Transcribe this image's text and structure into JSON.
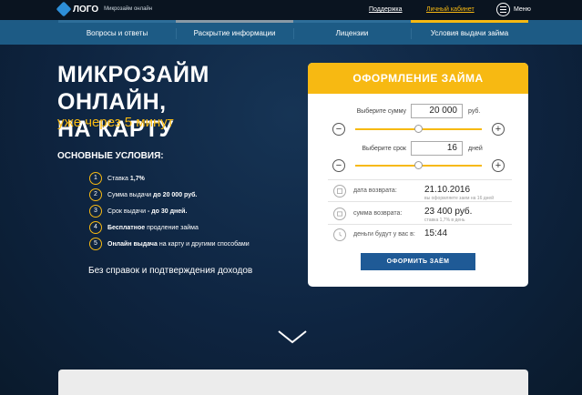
{
  "header": {
    "logo_text": "ЛОГО",
    "logo_sub": "Микрозайм онлайн",
    "support_link": "Поддержка",
    "cabinet_link": "Личный кабинет",
    "menu_label": "Меню"
  },
  "nav": {
    "items": [
      {
        "label": "Вопросы и ответы"
      },
      {
        "label": "Раскрытие информации"
      },
      {
        "label": "Лицензии"
      },
      {
        "label": "Условия выдачи займа"
      }
    ]
  },
  "hero": {
    "title_line1": "МИКРОЗАЙМ ОНЛАЙН,",
    "title_line2": "НА КАРТУ",
    "subtitle": "уже через 5 минут",
    "conditions_title": "ОСНОВНЫЕ УСЛОВИЯ:",
    "conditions": [
      {
        "num": "1",
        "pre": "Ставка ",
        "bold": "1,7%",
        "post": ""
      },
      {
        "num": "2",
        "pre": "Сумма выдачи ",
        "bold": "до 20 000 руб.",
        "post": ""
      },
      {
        "num": "3",
        "pre": "Срок выдачи ",
        "bold": "- до 30 дней.",
        "post": ""
      },
      {
        "num": "4",
        "pre": "",
        "bold": "Бесплатное",
        "post": " продление займа"
      },
      {
        "num": "5",
        "pre": "",
        "bold": "Онлайн выдача",
        "post": " на карту и другими способами"
      }
    ],
    "no_docs": "Без справок и подтверждения доходов"
  },
  "loan_form": {
    "title": "ОФОРМЛЕНИЕ ЗАЙМА",
    "amount_label": "Выберите сумму",
    "amount_value": "20 000",
    "amount_unit": "руб.",
    "amount_slider_fraction": 0.5,
    "term_label": "Выберите срок",
    "term_value": "16",
    "term_unit": "дней",
    "term_slider_fraction": 0.5,
    "minus_symbol": "−",
    "plus_symbol": "+",
    "return_date_label": "дата возврата:",
    "return_date_value": "21.10.2016",
    "return_date_note": "вы оформляете заем на 16 дней",
    "return_sum_label": "сумма возврата:",
    "return_sum_value": "23 400 руб.",
    "return_sum_note": "ставка 1,7% в день",
    "money_time_label": "деньги будут у вас в:",
    "money_time_value": "15:44",
    "submit_label": "ОФОРМИТЬ ЗАЁМ"
  },
  "colors": {
    "accent": "#f7b912",
    "nav_bg": "#1d5b85",
    "button": "#1f5a96"
  }
}
